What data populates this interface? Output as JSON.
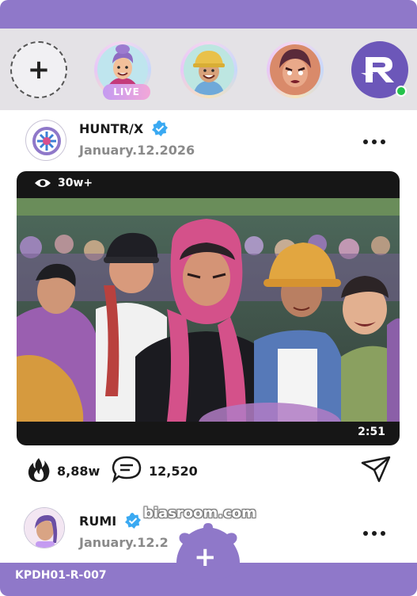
{
  "stories": {
    "add_label": "+",
    "live_badge": "LIVE"
  },
  "post1": {
    "author": "HUNTR/X",
    "date": "January.12.2026",
    "views": "30w+",
    "duration": "2:51",
    "likes": "8,88w",
    "comments": "12,520"
  },
  "post2": {
    "author": "RUMI",
    "date": "January.12.2"
  },
  "watermark": "biasroom.com",
  "footer": {
    "serial": "KPDH01-R-007",
    "add_label": "+"
  },
  "colors": {
    "accent": "#8f78c9",
    "verified": "#3aa9f2",
    "online": "#25c24b"
  },
  "icons": [
    "plus-icon",
    "verified-icon",
    "more-icon",
    "eye-icon",
    "fire-icon",
    "chat-icon",
    "send-icon",
    "brand-logo-icon"
  ]
}
